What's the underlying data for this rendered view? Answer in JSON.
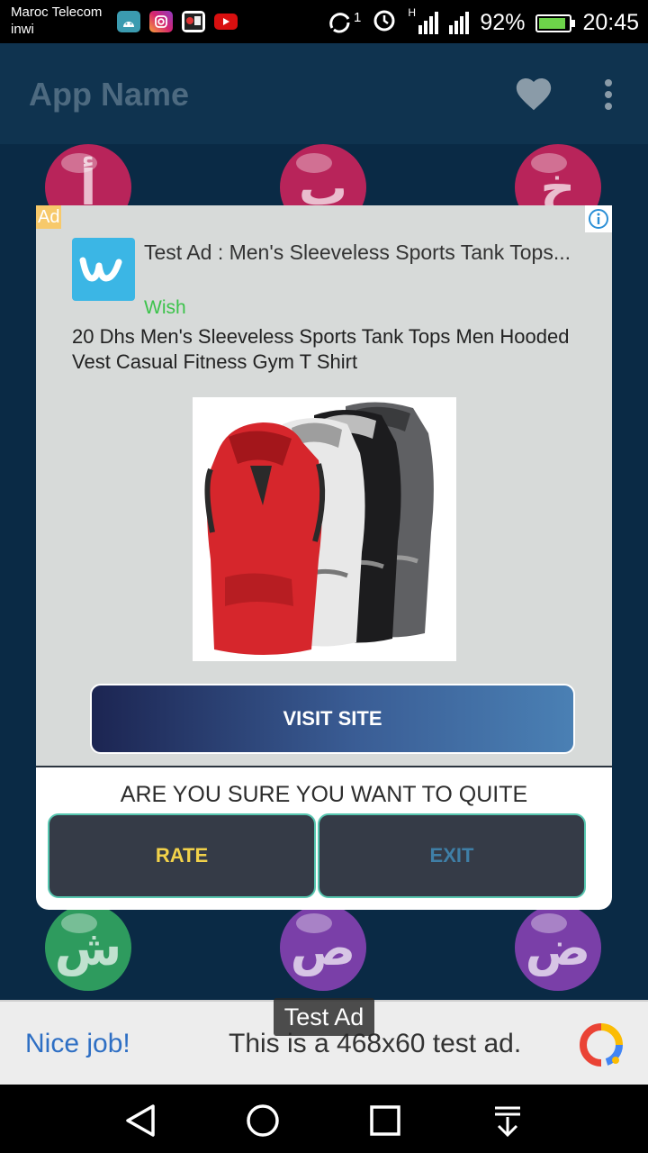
{
  "status_bar": {
    "carrier_line1": "Maroc Telecom",
    "carrier_line2": "inwi",
    "notification_icons": [
      "android-icon",
      "instagram-icon",
      "game-icon",
      "youtube-icon"
    ],
    "sim_indicator": "1",
    "network_type": "H",
    "battery_percent": "92%",
    "battery_level": 0.92,
    "time": "20:45"
  },
  "app_bar": {
    "title": "App Name",
    "favorite_icon": "heart-icon",
    "menu_icon": "more-vert-icon",
    "colors": {
      "background": "#0f334f",
      "title": "#4d6a80"
    }
  },
  "background_balls": [
    {
      "letter": "أ",
      "color": "#b8245a"
    },
    {
      "letter": "ب",
      "color": "#b8245a"
    },
    {
      "letter": "خ",
      "color": "#b8245a"
    },
    {
      "letter": "ش",
      "color": "#2e9b5e"
    },
    {
      "letter": "ص",
      "color": "#7a3fa8"
    },
    {
      "letter": "ض",
      "color": "#7a3fa8"
    }
  ],
  "dialog": {
    "native_ad": {
      "badge": "Ad",
      "info_icon": "info-icon",
      "advertiser_logo": "wish-logo",
      "headline": "Test Ad : Men's Sleeveless Sports Tank Tops...",
      "advertiser": "Wish",
      "body": "20 Dhs Men's Sleeveless Sports Tank Tops Men Hooded Vest Casual Fitness Gym T Shirt",
      "image": "tank-tops-image",
      "cta_label": "VISIT SITE"
    },
    "question": "ARE YOU SURE YOU WANT TO QUITE",
    "rate_label": "RATE",
    "exit_label": "EXIT",
    "colors": {
      "rate_text": "#f2d24a",
      "exit_text": "#3f7fa7",
      "button_border": "#57c7b0"
    }
  },
  "banner_ad": {
    "tag": "Test Ad",
    "lead": "Nice job!",
    "text": "This is a 468x60 test ad.",
    "logo": "admob-logo"
  },
  "nav_bar": {
    "back_icon": "back-icon",
    "home_icon": "home-icon",
    "recents_icon": "recents-icon",
    "notifications_icon": "pull-down-icon"
  }
}
